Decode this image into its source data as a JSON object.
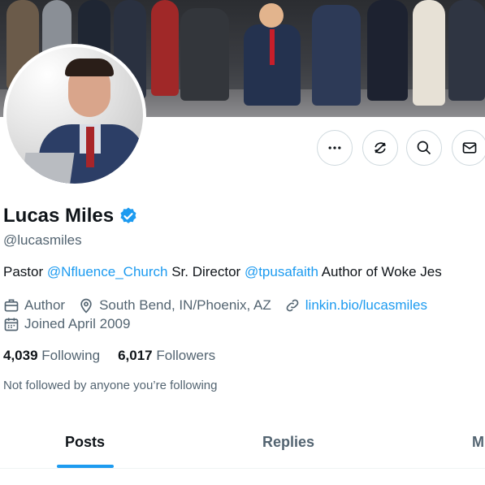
{
  "profile": {
    "name": "Lucas Miles",
    "handle": "@lucasmiles",
    "verified": true,
    "bio": {
      "pre": "Pastor ",
      "link1": "@Nfluence_Church",
      "mid": " Sr. Director ",
      "link2": "@tpusafaith",
      "post": " Author of Woke Jes"
    },
    "meta": {
      "profession": "Author",
      "location": "South Bend, IN/Phoenix, AZ",
      "website": "linkin.bio/lucasmiles",
      "joined": "Joined April 2009"
    },
    "stats": {
      "following_count": "4,039",
      "following_label": "Following",
      "followers_count": "6,017",
      "followers_label": "Followers"
    },
    "not_followed": "Not followed by anyone you’re following"
  },
  "actions": {
    "icons": [
      "more-icon",
      "subscribe-icon",
      "search-icon",
      "message-icon"
    ]
  },
  "tabs": [
    {
      "label": "Posts",
      "active": true
    },
    {
      "label": "Replies",
      "active": false
    },
    {
      "label": "M",
      "active": false
    }
  ],
  "colors": {
    "accent": "#1d9bf0",
    "text": "#0f1419",
    "secondary": "#536471",
    "border": "#cfd9de"
  }
}
